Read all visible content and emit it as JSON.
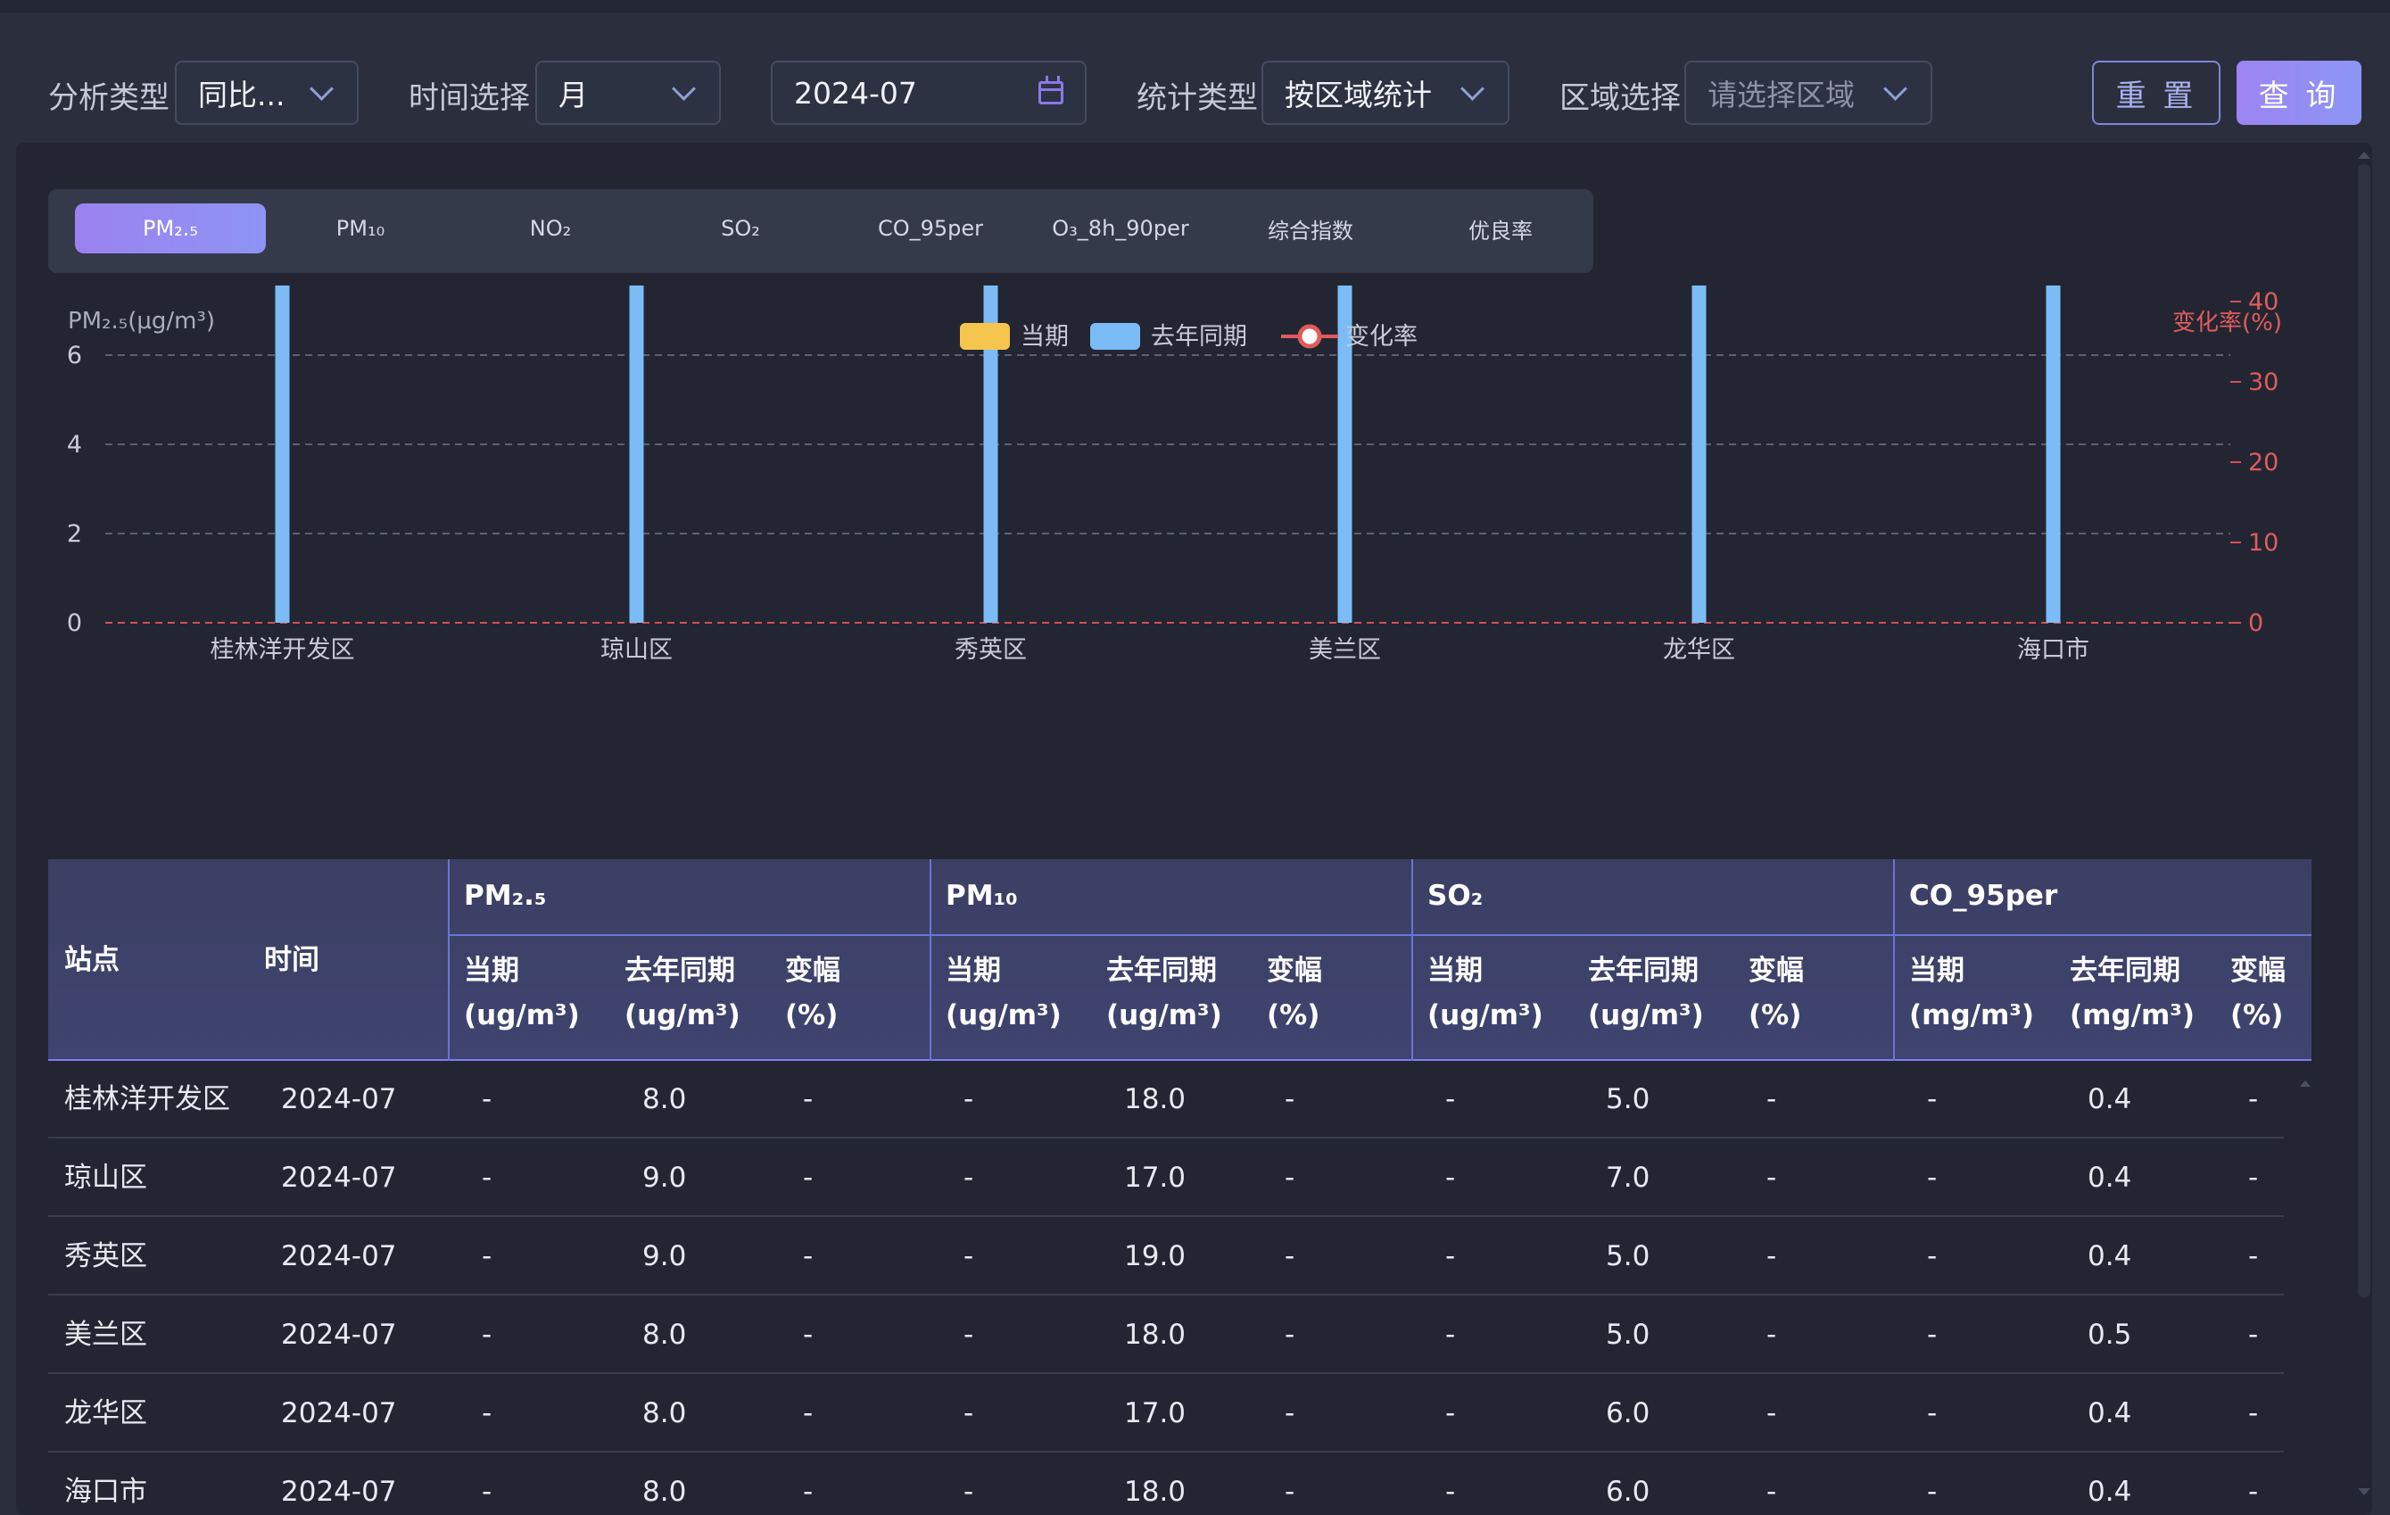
{
  "filters": {
    "analysis_type": {
      "label": "分析类型",
      "value": "同比..."
    },
    "time_select": {
      "label": "时间选择",
      "value": "月"
    },
    "date": {
      "value": "2024-07"
    },
    "stat_type": {
      "label": "统计类型",
      "value": "按区域统计"
    },
    "region": {
      "label": "区域选择",
      "placeholder": "请选择区域"
    },
    "reset_label": "重 置",
    "query_label": "查 询"
  },
  "tabs": [
    {
      "label": "PM₂.₅",
      "active": true
    },
    {
      "label": "PM₁₀"
    },
    {
      "label": "NO₂"
    },
    {
      "label": "SO₂"
    },
    {
      "label": "CO_95per"
    },
    {
      "label": "O₃_8h_90per"
    },
    {
      "label": "综合指数"
    },
    {
      "label": "优良率"
    }
  ],
  "chart_data": {
    "type": "bar",
    "ylabel": "PM₂.₅(μg/m³)",
    "y2label": "变化率(%)",
    "categories": [
      "桂林洋开发区",
      "琼山区",
      "秀英区",
      "美兰区",
      "龙华区",
      "海口市"
    ],
    "series": [
      {
        "name": "当期",
        "values": [
          null,
          null,
          null,
          null,
          null,
          null
        ],
        "color": "#f6c54e"
      },
      {
        "name": "去年同期",
        "values": [
          8,
          9,
          9,
          8,
          8,
          8
        ],
        "color": "#7bbcf7"
      },
      {
        "name": "变化率",
        "type": "line",
        "values": [
          null,
          null,
          null,
          null,
          null,
          null
        ],
        "color": "#e25b5b"
      }
    ],
    "ylim": [
      0,
      9
    ],
    "yticks": [
      "0",
      "2",
      "4",
      "6",
      "8",
      "9"
    ],
    "y2lim": [
      0,
      50
    ],
    "y2ticks": [
      "0",
      "10",
      "20",
      "30",
      "40",
      "50"
    ],
    "grid": true,
    "legend": "top-center"
  },
  "table": {
    "station_header": "站点",
    "time_header": "时间",
    "groups": [
      "PM₂.₅",
      "PM₁₀",
      "SO₂",
      "CO_95per"
    ],
    "sub_headers": [
      [
        "当期",
        "(ug/m³)"
      ],
      [
        "去年同期",
        "(ug/m³)"
      ],
      [
        "变幅",
        "(%)"
      ],
      [
        "当期",
        "(ug/m³)"
      ],
      [
        "去年同期",
        "(ug/m³)"
      ],
      [
        "变幅",
        "(%)"
      ],
      [
        "当期",
        "(ug/m³)"
      ],
      [
        "去年同期",
        "(ug/m³)"
      ],
      [
        "变幅",
        "(%)"
      ],
      [
        "当期",
        "(mg/m³)"
      ],
      [
        "去年同期",
        "(mg/m³)"
      ],
      [
        "变幅",
        "(%)"
      ]
    ],
    "rows": [
      [
        "桂林洋开发区",
        "2024-07",
        "-",
        "8.0",
        "-",
        "-",
        "18.0",
        "-",
        "-",
        "5.0",
        "-",
        "-",
        "0.4",
        "-"
      ],
      [
        "琼山区",
        "2024-07",
        "-",
        "9.0",
        "-",
        "-",
        "17.0",
        "-",
        "-",
        "7.0",
        "-",
        "-",
        "0.4",
        "-"
      ],
      [
        "秀英区",
        "2024-07",
        "-",
        "9.0",
        "-",
        "-",
        "19.0",
        "-",
        "-",
        "5.0",
        "-",
        "-",
        "0.4",
        "-"
      ],
      [
        "美兰区",
        "2024-07",
        "-",
        "8.0",
        "-",
        "-",
        "18.0",
        "-",
        "-",
        "5.0",
        "-",
        "-",
        "0.5",
        "-"
      ],
      [
        "龙华区",
        "2024-07",
        "-",
        "8.0",
        "-",
        "-",
        "17.0",
        "-",
        "-",
        "6.0",
        "-",
        "-",
        "0.4",
        "-"
      ],
      [
        "海口市",
        "2024-07",
        "-",
        "8.0",
        "-",
        "-",
        "18.0",
        "-",
        "-",
        "6.0",
        "-",
        "-",
        "0.4",
        "-"
      ]
    ]
  }
}
